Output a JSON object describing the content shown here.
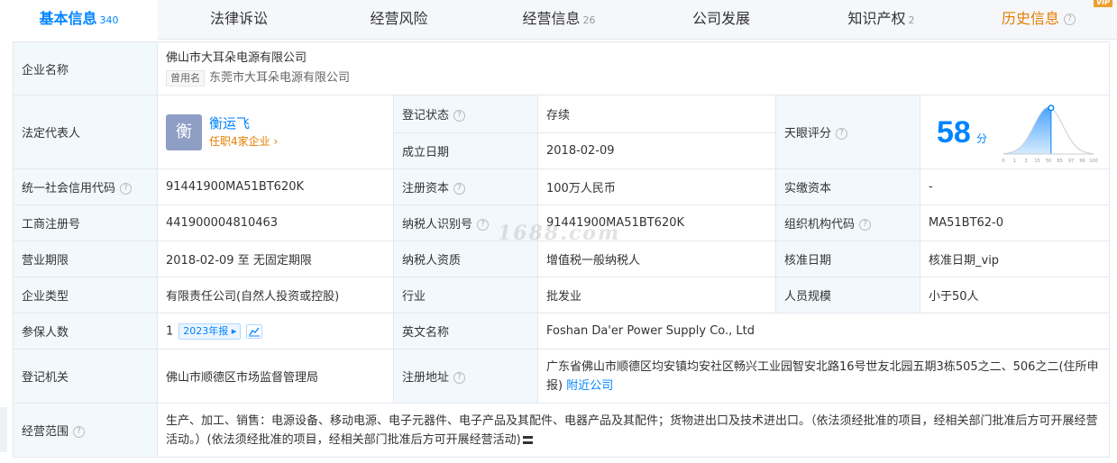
{
  "tabs": [
    {
      "label": "基本信息",
      "count": "340"
    },
    {
      "label": "法律诉讼",
      "count": ""
    },
    {
      "label": "经营风险",
      "count": ""
    },
    {
      "label": "经营信息",
      "count": "26"
    },
    {
      "label": "公司发展",
      "count": ""
    },
    {
      "label": "知识产权",
      "count": "2"
    },
    {
      "label": "历史信息",
      "count": "",
      "badge": "VIP"
    }
  ],
  "company": {
    "name_label": "企业名称",
    "name": "佛山市大耳朵电源有限公司",
    "former_tag": "曾用名",
    "former_name": "东莞市大耳朵电源有限公司"
  },
  "legal": {
    "label": "法定代表人",
    "avatar_char": "衡",
    "name": "衡运飞",
    "link": "任职4家企业 ›"
  },
  "reg_status": {
    "label": "登记状态",
    "value": "存续",
    "status_color": "#13a43a"
  },
  "founded": {
    "label": "成立日期",
    "value": "2018-02-09"
  },
  "score": {
    "label": "天眼评分",
    "value": 58,
    "unit": "分",
    "ticks": [
      "0",
      "1",
      "3",
      "15",
      "50",
      "85",
      "97",
      "99",
      "100"
    ]
  },
  "credit_code": {
    "label": "统一社会信用代码",
    "value": "91441900MA51BT620K"
  },
  "reg_capital": {
    "label": "注册资本",
    "value": "100万人民币"
  },
  "paid_capital": {
    "label": "实缴资本",
    "value": "-"
  },
  "biz_reg_no": {
    "label": "工商注册号",
    "value": "441900004810463"
  },
  "taxpayer_id": {
    "label": "纳税人识别号",
    "value": "91441900MA51BT620K"
  },
  "org_code": {
    "label": "组织机构代码",
    "value": "MA51BT62-0"
  },
  "term": {
    "label": "营业期限",
    "value": "2018-02-09 至 无固定期限"
  },
  "taxpayer_qual": {
    "label": "纳税人资质",
    "value": "增值税一般纳税人"
  },
  "approve_date": {
    "label": "核准日期",
    "value": "核准日期_vip"
  },
  "company_type": {
    "label": "企业类型",
    "value": "有限责任公司(自然人投资或控股)"
  },
  "industry": {
    "label": "行业",
    "value": "批发业"
  },
  "staff_size": {
    "label": "人员规模",
    "value": "小于50人"
  },
  "insured": {
    "label": "参保人数",
    "value": "1",
    "report_tag": "2023年报 ▸"
  },
  "english_name": {
    "label": "英文名称",
    "value": "Foshan Da'er Power Supply Co., Ltd"
  },
  "authority": {
    "label": "登记机关",
    "value": "佛山市顺德区市场监督管理局"
  },
  "address": {
    "label": "注册地址",
    "value": "广东省佛山市顺德区均安镇均安社区畅兴工业园智安北路16号世友北园五期3栋505之二、506之二(住所申报)",
    "nearby_link": "附近公司"
  },
  "scope": {
    "label": "经营范围",
    "value": "生产、加工、销售：电源设备、移动电源、电子元器件、电子产品及其配件、电器产品及其配件；货物进出口及技术进出口。（依法须经批准的项目，经相关部门批准后方可开展经营活动。）(依法须经批准的项目，经相关部门批准后方可开展经营活动)"
  },
  "watermark": "1688.com"
}
